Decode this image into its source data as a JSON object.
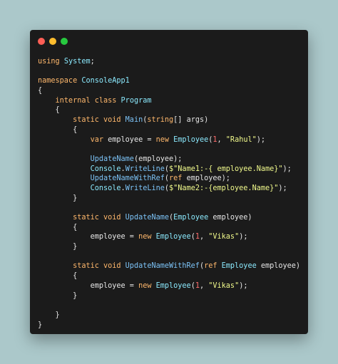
{
  "window": {
    "controls": [
      "close",
      "minimize",
      "maximize"
    ],
    "colors": {
      "close": "#ff5f56",
      "minimize": "#ffbd2e",
      "maximize": "#27c93f",
      "background": "#1b1b1b"
    }
  },
  "code": {
    "lines": [
      [
        {
          "t": "using ",
          "c": "kw"
        },
        {
          "t": "System",
          "c": "tp"
        },
        {
          "t": ";",
          "c": "pl"
        }
      ],
      [],
      [
        {
          "t": "namespace ",
          "c": "kw"
        },
        {
          "t": "ConsoleApp1",
          "c": "tp"
        }
      ],
      [
        {
          "t": "{",
          "c": "pl"
        }
      ],
      [
        {
          "t": "    internal class ",
          "c": "kw"
        },
        {
          "t": "Program",
          "c": "tp"
        }
      ],
      [
        {
          "t": "    {",
          "c": "pl"
        }
      ],
      [
        {
          "t": "        static void ",
          "c": "kw"
        },
        {
          "t": "Main",
          "c": "fn"
        },
        {
          "t": "(",
          "c": "pl"
        },
        {
          "t": "string",
          "c": "kw"
        },
        {
          "t": "[] args)",
          "c": "pl"
        }
      ],
      [
        {
          "t": "        {",
          "c": "pl"
        }
      ],
      [
        {
          "t": "            var ",
          "c": "kw"
        },
        {
          "t": "employee = ",
          "c": "pl"
        },
        {
          "t": "new ",
          "c": "kw"
        },
        {
          "t": "Employee",
          "c": "tp"
        },
        {
          "t": "(",
          "c": "pl"
        },
        {
          "t": "1",
          "c": "nm"
        },
        {
          "t": ", ",
          "c": "pl"
        },
        {
          "t": "\"Rahul\"",
          "c": "st"
        },
        {
          "t": ");",
          "c": "pl"
        }
      ],
      [],
      [
        {
          "t": "            ",
          "c": "pl"
        },
        {
          "t": "UpdateName",
          "c": "fn"
        },
        {
          "t": "(employee);",
          "c": "pl"
        }
      ],
      [
        {
          "t": "            ",
          "c": "pl"
        },
        {
          "t": "Console",
          "c": "tp"
        },
        {
          "t": ".",
          "c": "pl"
        },
        {
          "t": "WriteLine",
          "c": "fn"
        },
        {
          "t": "(",
          "c": "pl"
        },
        {
          "t": "$\"Name1:-{ employee.Name}\"",
          "c": "st"
        },
        {
          "t": ");",
          "c": "pl"
        }
      ],
      [
        {
          "t": "            ",
          "c": "pl"
        },
        {
          "t": "UpdateNameWithRef",
          "c": "fn"
        },
        {
          "t": "(",
          "c": "pl"
        },
        {
          "t": "ref ",
          "c": "kw"
        },
        {
          "t": "employee);",
          "c": "pl"
        }
      ],
      [
        {
          "t": "            ",
          "c": "pl"
        },
        {
          "t": "Console",
          "c": "tp"
        },
        {
          "t": ".",
          "c": "pl"
        },
        {
          "t": "WriteLine",
          "c": "fn"
        },
        {
          "t": "(",
          "c": "pl"
        },
        {
          "t": "$\"Name2:-{employee.Name}\"",
          "c": "st"
        },
        {
          "t": ");",
          "c": "pl"
        }
      ],
      [
        {
          "t": "        }",
          "c": "pl"
        }
      ],
      [],
      [
        {
          "t": "        static void ",
          "c": "kw"
        },
        {
          "t": "UpdateName",
          "c": "fn"
        },
        {
          "t": "(",
          "c": "pl"
        },
        {
          "t": "Employee ",
          "c": "tp"
        },
        {
          "t": "employee)",
          "c": "pl"
        }
      ],
      [
        {
          "t": "        {",
          "c": "pl"
        }
      ],
      [
        {
          "t": "            employee = ",
          "c": "pl"
        },
        {
          "t": "new ",
          "c": "kw"
        },
        {
          "t": "Employee",
          "c": "tp"
        },
        {
          "t": "(",
          "c": "pl"
        },
        {
          "t": "1",
          "c": "nm"
        },
        {
          "t": ", ",
          "c": "pl"
        },
        {
          "t": "\"Vikas\"",
          "c": "st"
        },
        {
          "t": ");",
          "c": "pl"
        }
      ],
      [
        {
          "t": "        }",
          "c": "pl"
        }
      ],
      [],
      [
        {
          "t": "        static void ",
          "c": "kw"
        },
        {
          "t": "UpdateNameWithRef",
          "c": "fn"
        },
        {
          "t": "(",
          "c": "pl"
        },
        {
          "t": "ref ",
          "c": "kw"
        },
        {
          "t": "Employee ",
          "c": "tp"
        },
        {
          "t": "employee)",
          "c": "pl"
        }
      ],
      [
        {
          "t": "        {",
          "c": "pl"
        }
      ],
      [
        {
          "t": "            employee = ",
          "c": "pl"
        },
        {
          "t": "new ",
          "c": "kw"
        },
        {
          "t": "Employee",
          "c": "tp"
        },
        {
          "t": "(",
          "c": "pl"
        },
        {
          "t": "1",
          "c": "nm"
        },
        {
          "t": ", ",
          "c": "pl"
        },
        {
          "t": "\"Vikas\"",
          "c": "st"
        },
        {
          "t": ");",
          "c": "pl"
        }
      ],
      [
        {
          "t": "        }",
          "c": "pl"
        }
      ],
      [],
      [
        {
          "t": "    }",
          "c": "pl"
        }
      ],
      [
        {
          "t": "}",
          "c": "pl"
        }
      ]
    ]
  }
}
